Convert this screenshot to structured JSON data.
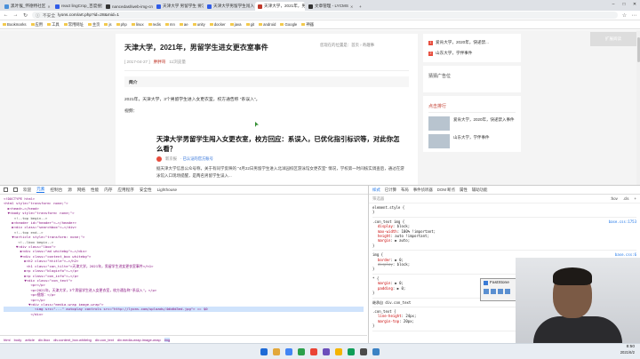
{
  "browser": {
    "tabs": [
      {
        "label": "黑叶猴_怀德特社区",
        "color": "#4a90d9"
      },
      {
        "label": "react lingCrop_百度搜索",
        "color": "#2f5be7"
      },
      {
        "label": "nancedasl/web-img-crop",
        "color": "#333333"
      },
      {
        "label": "天津大学 男留学生 要求女...搜索",
        "color": "#2f5be7"
      },
      {
        "label": "天津大学男留学生闯入女宿",
        "color": "#2f5be7"
      },
      {
        "label": "天津大学，2021年，男留学生",
        "color": "#c0392b",
        "active": true
      },
      {
        "label": "文章管理 - LYCMS",
        "color": "#333333"
      }
    ],
    "url_warning": "不安全",
    "url": "lyons.com/art.php?id=28&mid=1",
    "bookmarks": [
      "Bookmarks",
      "应用",
      "工具",
      "常用网址",
      "主页",
      "js",
      "php",
      "linux",
      "redis",
      "mn",
      "ae",
      "unity",
      "docker",
      "java",
      "git",
      "android",
      "Google",
      "神器"
    ]
  },
  "article": {
    "breadcrumb": "您现在的位置是：首页 › 奇趣事",
    "title": "天津大学，2021年，男留学生进女更衣室事件",
    "date": "[ 2017-04-27 ]",
    "author": "胖胖哥",
    "views": "11浏览量",
    "summary_label": "简介",
    "paragraph": "2021年，天津大学，3个男留学生进入女更衣室，校方通告称 \"系误入\"。",
    "video_label": "视频：",
    "embed_title": "天津大学男留学生闯入女更衣室，校方回应：系误入，已优化指引标识等，对此你怎么看？",
    "embed_author": "新京报",
    "embed_source": "· 已认证的官方账号",
    "embed_body": "据天津大学信息公众号称，关于有同学反映的 \"4月22日男留学生进入北洋园校区游泳馆女更衣室\" 情况，学校第一时间核实调查后，通过在游泳馆入口现场提醒，是两名男留学生误入..."
  },
  "sidebar": {
    "top_items": [
      {
        "num": "1",
        "text": "爱肯大学，2020年，快递禁..."
      },
      {
        "num": "2",
        "text": "山东大学，学伴事件"
      }
    ],
    "ad_label": "猜猜广告位",
    "hot_title": "点击排行",
    "hot_items": [
      "爱肯大学，2020年，快递禁入事件",
      "山东大学，学伴事件"
    ],
    "card_label": "扩展阅读"
  },
  "devtools": {
    "tabs": [
      "欢迎",
      "元素",
      "控制台",
      "源",
      "网络",
      "性能",
      "内存",
      "应用程序",
      "安全性",
      "Lighthouse"
    ],
    "active_tab": "元素",
    "dom_lines": [
      "<!DOCTYPE html>",
      "<html style=\"transform: none;\">",
      "  ▶<head>…</head>",
      "  ▼<body style=\"transform: none;\">",
      "     <!--top begin-->",
      "    ▶<header id=\"header\">…</header>",
      "    ▶<div class=\"searchbox\">…</div>",
      "     <!--top end-->",
      "    ▼<article style=\"transform: none;\">",
      "       <!--lbox begin-->",
      "      ▼<div class=\"lbox\">",
      "        ▶<div class=\"ad whitebg\">…</div>",
      "        ▼<div class=\"content_box whitebg\">",
      "          ▶<h2 class=\"htitle\">…</h2>",
      "           <h1 class=\"con_tilte\">天津大学，2021年，男留学生进女更衣室事件</h1>",
      "          ▶<p class=\"bloginfo\">…</p>",
      "          ▶<p class=\"con_info\">…</p>",
      "          ▼<div class=\"con_text\">",
      "             <p></p>",
      "             <p>2021年，天津大学，3个男留学生进入女更衣室，校方通告称\"系误入\"。</p>",
      "             <p>视频：</p>",
      "             <p></p>",
      "            ▼<div class=\"media-wrap image-wrap\">",
      "               <img src=\"...\" autoplay controls src=\"http://lyons.com/uploads/4db6d3ed.jpg\"> == $0",
      "             </div>"
    ],
    "highlight_index": 23,
    "dom_crumbs": [
      "html",
      "body",
      "article",
      "div.lbox",
      "div.content_box.whitebg",
      "div.con_text",
      "div.media-wrap.image-wrap",
      "img"
    ],
    "styles_tabs": [
      "样式",
      "已计算",
      "布局",
      "事件侦听器",
      "DOM 断点",
      "属性",
      "辅助功能"
    ],
    "filter_placeholder": "筛选器",
    "filter_buttons": [
      ":hov",
      ".cls",
      "+"
    ],
    "rules": [
      {
        "selector": "element.style {",
        "props": [],
        "source": ""
      },
      {
        "selector": ".con_text img {",
        "props": [
          "display: block;",
          "max-width: 100% !important;",
          "height: auto !important;",
          "margin: ▶ auto;"
        ],
        "source": "base.css:1753"
      },
      {
        "selector": "img {",
        "props": [
          "border: ▶ 0;",
          "display: block;"
        ],
        "source": "base.css:6"
      },
      {
        "selector": "* {",
        "props": [
          "margin: ▶ 0;",
          "padding: ▶ 0;"
        ],
        "source": "base.css:1"
      },
      {
        "selector": "继承自 div.con_text",
        "props": [],
        "source": ""
      },
      {
        "selector": ".con_text {",
        "props": [
          "line-height: 24px;",
          "margin-top: 20px;"
        ],
        "source": "base.css:1761"
      }
    ]
  },
  "overlay": {
    "app_name": "FastStone"
  },
  "taskbar": {
    "time": "8:50",
    "date": "2021/6/2",
    "icon_colors": [
      "#1e6ad6",
      "#e2a73b",
      "#4285f4",
      "#2ba04b",
      "#ea4335",
      "#6b4fbb",
      "#f4b400",
      "#0f9d58",
      "#4a4a4a",
      "#3b82c4"
    ]
  }
}
